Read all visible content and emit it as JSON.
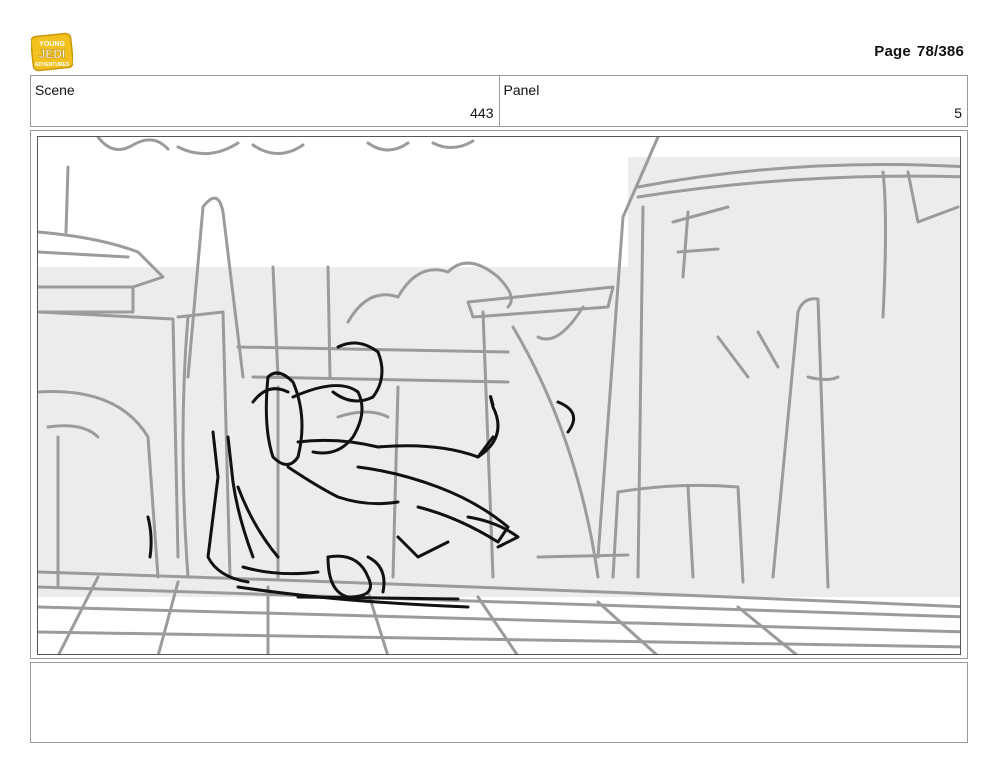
{
  "header": {
    "logo_text_top": "YOUNG",
    "logo_text_mid": "JEDI",
    "logo_text_bottom": "ADVENTURES",
    "page_label": "Page",
    "page_number": "78/386"
  },
  "info": {
    "scene_label": "Scene",
    "scene_value": "443",
    "panel_label": "Panel",
    "panel_value": "5"
  },
  "notes": {
    "text": ""
  },
  "colors": {
    "border": "#9a9a9a",
    "sketch_gray": "#9b9b9b",
    "sketch_black": "#111111",
    "logo_yellow": "#f2c11d"
  }
}
